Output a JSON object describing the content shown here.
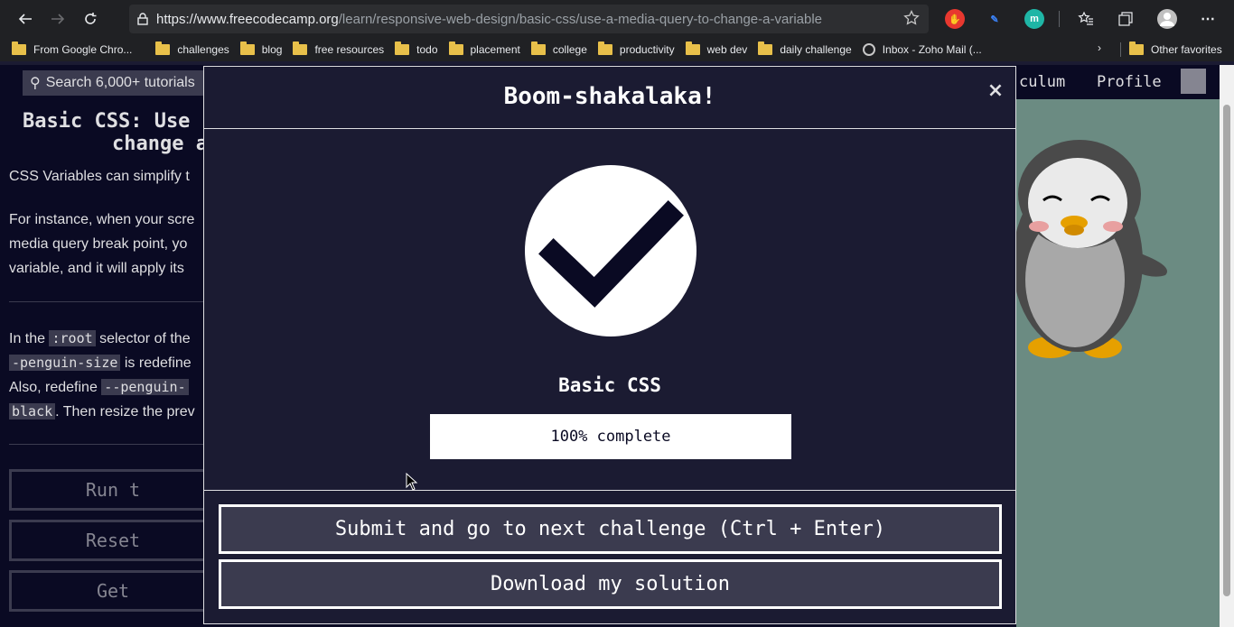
{
  "browser": {
    "url_host": "https://www.freecodecamp.org",
    "url_path": "/learn/responsive-web-design/basic-css/use-a-media-query-to-change-a-variable",
    "bookmarks": [
      "From Google Chro...",
      "challenges",
      "blog",
      "free resources",
      "todo",
      "placement",
      "college",
      "productivity",
      "web dev",
      "daily challenge",
      "Inbox - Zoho Mail (..."
    ],
    "other_favorites": "Other favorites"
  },
  "fcc_nav": {
    "search_placeholder": "Search 6,000+ tutorials",
    "curriculum": "culum",
    "profile": "Profile"
  },
  "lesson": {
    "title_line1": "Basic CSS: Use",
    "title_line2": "change a",
    "para1": "CSS Variables can simplify t",
    "para2_l1": "For instance, when your scre",
    "para2_l2": "media query break point, yo",
    "para2_l3": "variable, and it will apply its",
    "para3_l1a": "In the",
    "para3_l1_code": ":root",
    "para3_l1b": "selector of the",
    "para3_l2_code": "-penguin-size",
    "para3_l2b": "is redefine",
    "para3_l3a": "Also, redefine",
    "para3_l3_code": "--penguin-",
    "para3_l4_code": "black",
    "para3_l4b": ". Then resize the prev",
    "btn_run": "Run t",
    "btn_reset": "Reset",
    "btn_get": "Get"
  },
  "modal": {
    "title": "Boom-shakalaka!",
    "close": "×",
    "block": "Basic CSS",
    "progress_label": "100% complete",
    "progress_value": 100,
    "submit_button": "Submit and go to next challenge (Ctrl + Enter)",
    "download_button": "Download my solution"
  }
}
